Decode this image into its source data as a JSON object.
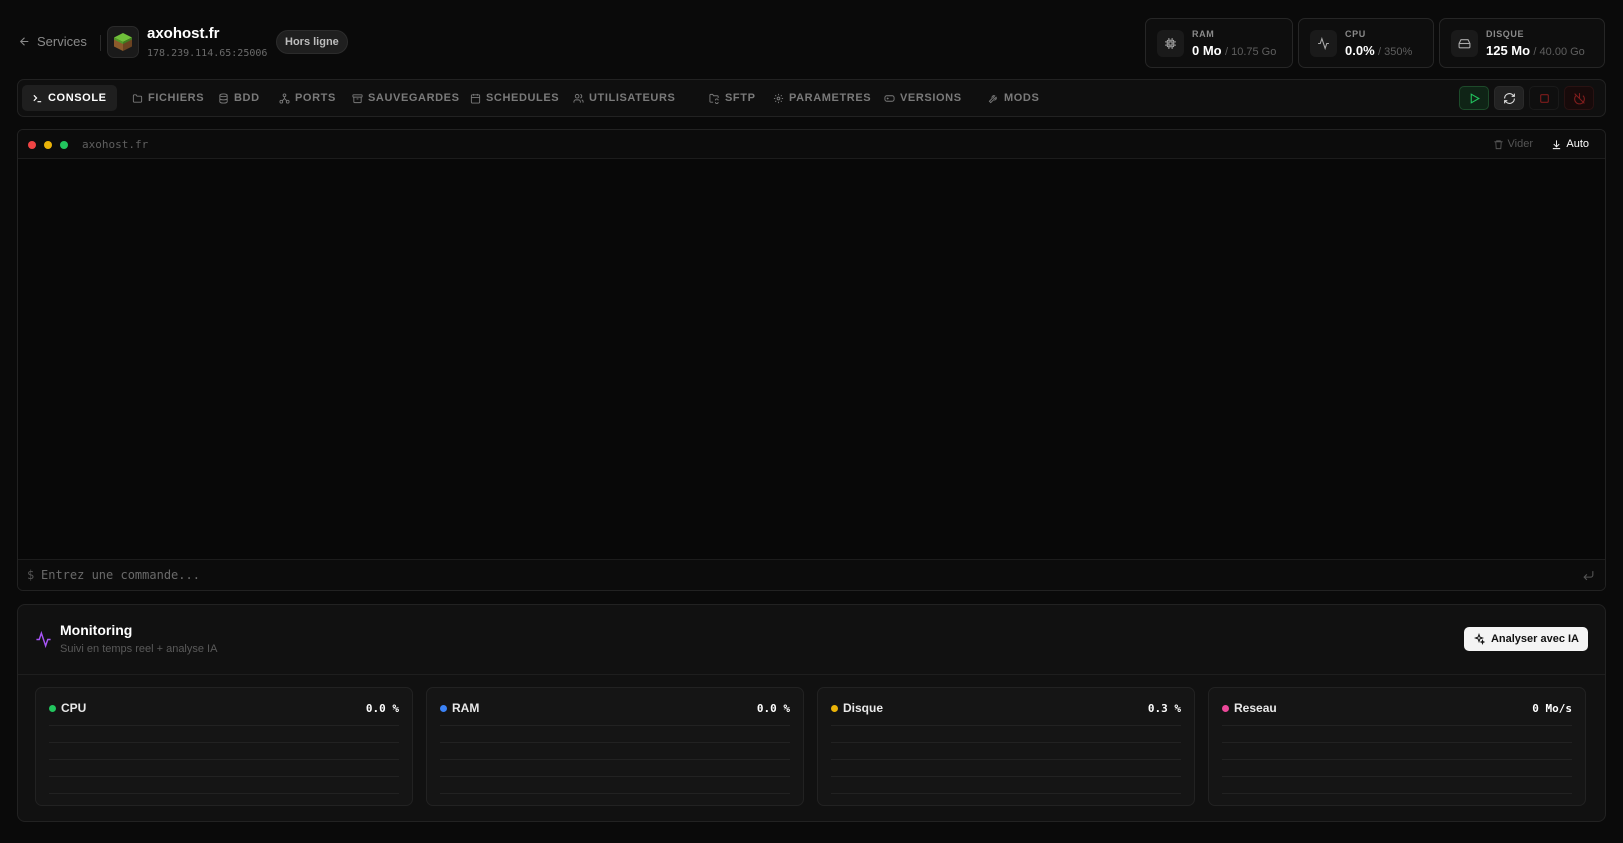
{
  "header": {
    "back_label": "Services",
    "server_name": "axohost.fr",
    "server_address": "178.239.114.65:25006",
    "status": "Hors ligne",
    "stats": [
      {
        "label": "RAM",
        "value": "0 Mo",
        "max": "/ 10.75 Go",
        "icon": "chip-icon"
      },
      {
        "label": "CPU",
        "value": "0.0%",
        "max": "/ 350%",
        "icon": "activity-icon"
      },
      {
        "label": "DISQUE",
        "value": "125 Mo",
        "max": "/ 40.00 Go",
        "icon": "hard-drive-icon"
      }
    ]
  },
  "tabs": [
    {
      "label": "CONSOLE",
      "icon": "terminal-icon",
      "active": true
    },
    {
      "label": "FICHIERS",
      "icon": "folder-icon"
    },
    {
      "label": "BDD",
      "icon": "database-icon"
    },
    {
      "label": "PORTS",
      "icon": "network-icon"
    },
    {
      "label": "SAUVEGARDES",
      "icon": "archive-icon"
    },
    {
      "label": "SCHEDULES",
      "icon": "calendar-icon"
    },
    {
      "label": "UTILISATEURS",
      "icon": "users-icon"
    },
    {
      "label": "SFTP",
      "icon": "folder-sync-icon"
    },
    {
      "label": "PARAMETRES",
      "icon": "gear-icon"
    },
    {
      "label": "VERSIONS",
      "icon": "gamepad-icon"
    },
    {
      "label": "MODS",
      "icon": "wrench-icon"
    }
  ],
  "power": {
    "start_icon": "play-icon",
    "restart_icon": "refresh-icon",
    "stop_icon": "stop-icon",
    "kill_icon": "kill-icon",
    "colors": {
      "start": "#22c55e",
      "stop": "#7f1d1d"
    }
  },
  "console": {
    "title": "axohost.fr",
    "clear_label": "Vider",
    "auto_label": "Auto",
    "prompt": "$",
    "input_placeholder": "Entrez une commande..."
  },
  "monitoring": {
    "title": "Monitoring",
    "subtitle": "Suivi en temps reel + analyse IA",
    "ai_button": "Analyser avec IA",
    "cards": [
      {
        "name": "CPU",
        "value": "0.0 %",
        "color": "#22c55e"
      },
      {
        "name": "RAM",
        "value": "0.0 %",
        "color": "#3b82f6"
      },
      {
        "name": "Disque",
        "value": "0.3 %",
        "color": "#eab308"
      },
      {
        "name": "Reseau",
        "value": "0 Mo/s",
        "color": "#ec4899"
      }
    ]
  }
}
